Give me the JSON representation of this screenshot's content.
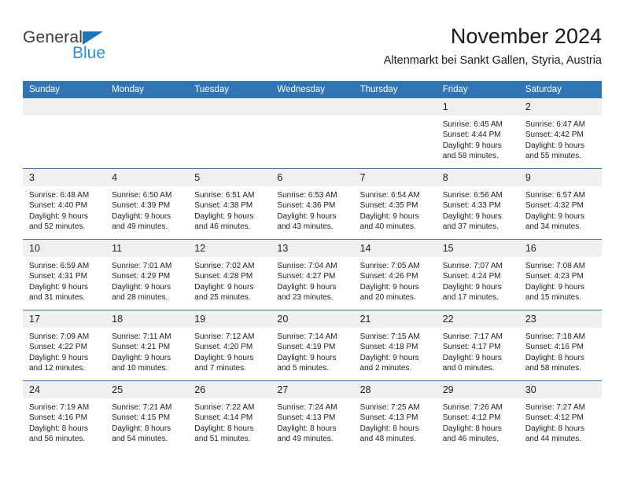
{
  "brand": {
    "word_top": "General",
    "word_bottom": "Blue",
    "triangle_color": "#1b75bc",
    "blue_text_color": "#2a8fd4"
  },
  "header": {
    "title": "November 2024",
    "subtitle": "Altenmarkt bei Sankt Gallen, Styria, Austria",
    "accent_color": "#3175b5",
    "band_color": "#f0f0f0"
  },
  "calendar": {
    "weekday_headers": [
      "Sunday",
      "Monday",
      "Tuesday",
      "Wednesday",
      "Thursday",
      "Friday",
      "Saturday"
    ],
    "weeks": [
      [
        {
          "day": "",
          "lines": []
        },
        {
          "day": "",
          "lines": []
        },
        {
          "day": "",
          "lines": []
        },
        {
          "day": "",
          "lines": []
        },
        {
          "day": "",
          "lines": []
        },
        {
          "day": "1",
          "lines": [
            "Sunrise: 6:45 AM",
            "Sunset: 4:44 PM",
            "Daylight: 9 hours",
            "and 58 minutes."
          ]
        },
        {
          "day": "2",
          "lines": [
            "Sunrise: 6:47 AM",
            "Sunset: 4:42 PM",
            "Daylight: 9 hours",
            "and 55 minutes."
          ]
        }
      ],
      [
        {
          "day": "3",
          "lines": [
            "Sunrise: 6:48 AM",
            "Sunset: 4:40 PM",
            "Daylight: 9 hours",
            "and 52 minutes."
          ]
        },
        {
          "day": "4",
          "lines": [
            "Sunrise: 6:50 AM",
            "Sunset: 4:39 PM",
            "Daylight: 9 hours",
            "and 49 minutes."
          ]
        },
        {
          "day": "5",
          "lines": [
            "Sunrise: 6:51 AM",
            "Sunset: 4:38 PM",
            "Daylight: 9 hours",
            "and 46 minutes."
          ]
        },
        {
          "day": "6",
          "lines": [
            "Sunrise: 6:53 AM",
            "Sunset: 4:36 PM",
            "Daylight: 9 hours",
            "and 43 minutes."
          ]
        },
        {
          "day": "7",
          "lines": [
            "Sunrise: 6:54 AM",
            "Sunset: 4:35 PM",
            "Daylight: 9 hours",
            "and 40 minutes."
          ]
        },
        {
          "day": "8",
          "lines": [
            "Sunrise: 6:56 AM",
            "Sunset: 4:33 PM",
            "Daylight: 9 hours",
            "and 37 minutes."
          ]
        },
        {
          "day": "9",
          "lines": [
            "Sunrise: 6:57 AM",
            "Sunset: 4:32 PM",
            "Daylight: 9 hours",
            "and 34 minutes."
          ]
        }
      ],
      [
        {
          "day": "10",
          "lines": [
            "Sunrise: 6:59 AM",
            "Sunset: 4:31 PM",
            "Daylight: 9 hours",
            "and 31 minutes."
          ]
        },
        {
          "day": "11",
          "lines": [
            "Sunrise: 7:01 AM",
            "Sunset: 4:29 PM",
            "Daylight: 9 hours",
            "and 28 minutes."
          ]
        },
        {
          "day": "12",
          "lines": [
            "Sunrise: 7:02 AM",
            "Sunset: 4:28 PM",
            "Daylight: 9 hours",
            "and 25 minutes."
          ]
        },
        {
          "day": "13",
          "lines": [
            "Sunrise: 7:04 AM",
            "Sunset: 4:27 PM",
            "Daylight: 9 hours",
            "and 23 minutes."
          ]
        },
        {
          "day": "14",
          "lines": [
            "Sunrise: 7:05 AM",
            "Sunset: 4:26 PM",
            "Daylight: 9 hours",
            "and 20 minutes."
          ]
        },
        {
          "day": "15",
          "lines": [
            "Sunrise: 7:07 AM",
            "Sunset: 4:24 PM",
            "Daylight: 9 hours",
            "and 17 minutes."
          ]
        },
        {
          "day": "16",
          "lines": [
            "Sunrise: 7:08 AM",
            "Sunset: 4:23 PM",
            "Daylight: 9 hours",
            "and 15 minutes."
          ]
        }
      ],
      [
        {
          "day": "17",
          "lines": [
            "Sunrise: 7:09 AM",
            "Sunset: 4:22 PM",
            "Daylight: 9 hours",
            "and 12 minutes."
          ]
        },
        {
          "day": "18",
          "lines": [
            "Sunrise: 7:11 AM",
            "Sunset: 4:21 PM",
            "Daylight: 9 hours",
            "and 10 minutes."
          ]
        },
        {
          "day": "19",
          "lines": [
            "Sunrise: 7:12 AM",
            "Sunset: 4:20 PM",
            "Daylight: 9 hours",
            "and 7 minutes."
          ]
        },
        {
          "day": "20",
          "lines": [
            "Sunrise: 7:14 AM",
            "Sunset: 4:19 PM",
            "Daylight: 9 hours",
            "and 5 minutes."
          ]
        },
        {
          "day": "21",
          "lines": [
            "Sunrise: 7:15 AM",
            "Sunset: 4:18 PM",
            "Daylight: 9 hours",
            "and 2 minutes."
          ]
        },
        {
          "day": "22",
          "lines": [
            "Sunrise: 7:17 AM",
            "Sunset: 4:17 PM",
            "Daylight: 9 hours",
            "and 0 minutes."
          ]
        },
        {
          "day": "23",
          "lines": [
            "Sunrise: 7:18 AM",
            "Sunset: 4:16 PM",
            "Daylight: 8 hours",
            "and 58 minutes."
          ]
        }
      ],
      [
        {
          "day": "24",
          "lines": [
            "Sunrise: 7:19 AM",
            "Sunset: 4:16 PM",
            "Daylight: 8 hours",
            "and 56 minutes."
          ]
        },
        {
          "day": "25",
          "lines": [
            "Sunrise: 7:21 AM",
            "Sunset: 4:15 PM",
            "Daylight: 8 hours",
            "and 54 minutes."
          ]
        },
        {
          "day": "26",
          "lines": [
            "Sunrise: 7:22 AM",
            "Sunset: 4:14 PM",
            "Daylight: 8 hours",
            "and 51 minutes."
          ]
        },
        {
          "day": "27",
          "lines": [
            "Sunrise: 7:24 AM",
            "Sunset: 4:13 PM",
            "Daylight: 8 hours",
            "and 49 minutes."
          ]
        },
        {
          "day": "28",
          "lines": [
            "Sunrise: 7:25 AM",
            "Sunset: 4:13 PM",
            "Daylight: 8 hours",
            "and 48 minutes."
          ]
        },
        {
          "day": "29",
          "lines": [
            "Sunrise: 7:26 AM",
            "Sunset: 4:12 PM",
            "Daylight: 8 hours",
            "and 46 minutes."
          ]
        },
        {
          "day": "30",
          "lines": [
            "Sunrise: 7:27 AM",
            "Sunset: 4:12 PM",
            "Daylight: 8 hours",
            "and 44 minutes."
          ]
        }
      ]
    ]
  }
}
